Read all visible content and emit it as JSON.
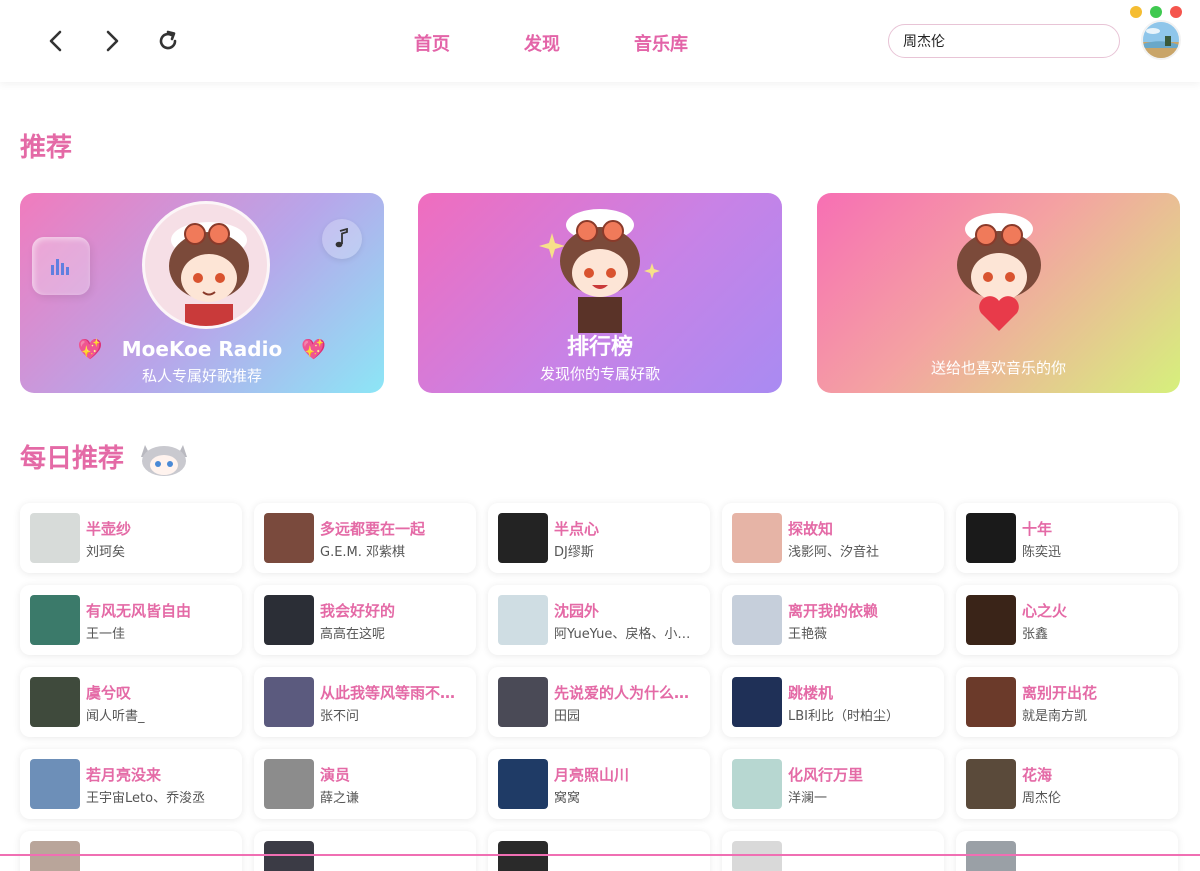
{
  "window": {
    "controls": [
      {
        "color": "#f5bd32"
      },
      {
        "color": "#3fc950"
      },
      {
        "color": "#f5554d"
      }
    ]
  },
  "header": {
    "icons": {
      "back": "chevron-left-icon",
      "forward": "chevron-right-icon",
      "refresh": "refresh-icon"
    },
    "nav": [
      "首页",
      "发现",
      "音乐库"
    ],
    "search_value": "周杰伦",
    "accent_color": "#e364a8"
  },
  "recommend": {
    "title": "推荐",
    "cards": [
      {
        "title": "MoeKoe Radio",
        "subtitle": "私人专属好歌推荐"
      },
      {
        "title": "排行榜",
        "subtitle": "发现你的专属好歌"
      },
      {
        "title": "",
        "subtitle": "送给也喜欢音乐的你"
      }
    ]
  },
  "daily": {
    "title": "每日推荐",
    "songs": [
      {
        "title": "半壶纱",
        "artist": "刘珂矣",
        "cover": "#d7dbd9"
      },
      {
        "title": "多远都要在一起",
        "artist": "G.E.M. 邓紫棋",
        "cover": "#7a4a3d"
      },
      {
        "title": "半点心",
        "artist": "DJ缪斯",
        "cover": "#232323"
      },
      {
        "title": "探故知",
        "artist": "浅影阿、汐音社",
        "cover": "#e6b4a6"
      },
      {
        "title": "十年",
        "artist": "陈奕迅",
        "cover": "#1a1a1a"
      },
      {
        "title": "有风无风皆自由",
        "artist": "王一佳",
        "cover": "#3b7a6a"
      },
      {
        "title": "我会好好的",
        "artist": "高高在这呢",
        "cover": "#2b2e36"
      },
      {
        "title": "沈园外",
        "artist": "阿YueYue、戾格、小田音乐社",
        "cover": "#cfdde3"
      },
      {
        "title": "离开我的依赖",
        "artist": "王艳薇",
        "cover": "#c6cfdb"
      },
      {
        "title": "心之火",
        "artist": "张鑫",
        "cover": "#3a2418"
      },
      {
        "title": "虞兮叹",
        "artist": "闻人听書_",
        "cover": "#3f4a3c"
      },
      {
        "title": "从此我等风等雨不等你",
        "artist": "张不问",
        "cover": "#5b5a7e"
      },
      {
        "title": "先说爱的人为什么先离开",
        "artist": "田园",
        "cover": "#4a4a56"
      },
      {
        "title": "跳楼机",
        "artist": "LBI利比（时柏尘）",
        "cover": "#1f3057"
      },
      {
        "title": "离别开出花",
        "artist": "就是南方凯",
        "cover": "#6b3a2a"
      },
      {
        "title": "若月亮没来",
        "artist": "王宇宙Leto、乔浚丞",
        "cover": "#6d8fb8"
      },
      {
        "title": "演员",
        "artist": "薛之谦",
        "cover": "#8c8c8c"
      },
      {
        "title": "月亮照山川",
        "artist": "窝窝",
        "cover": "#1f3b66"
      },
      {
        "title": "化风行万里",
        "artist": "洋澜一",
        "cover": "#b7d7d1"
      },
      {
        "title": "花海",
        "artist": "周杰伦",
        "cover": "#5a4a3a"
      },
      {
        "title": "",
        "artist": "",
        "cover": "#b9a59a"
      },
      {
        "title": "",
        "artist": "",
        "cover": "#3b3b45"
      },
      {
        "title": "",
        "artist": "",
        "cover": "#2a2a2a"
      },
      {
        "title": "",
        "artist": "",
        "cover": "#d9d9d9"
      },
      {
        "title": "",
        "artist": "",
        "cover": "#9aa0a6"
      }
    ]
  }
}
